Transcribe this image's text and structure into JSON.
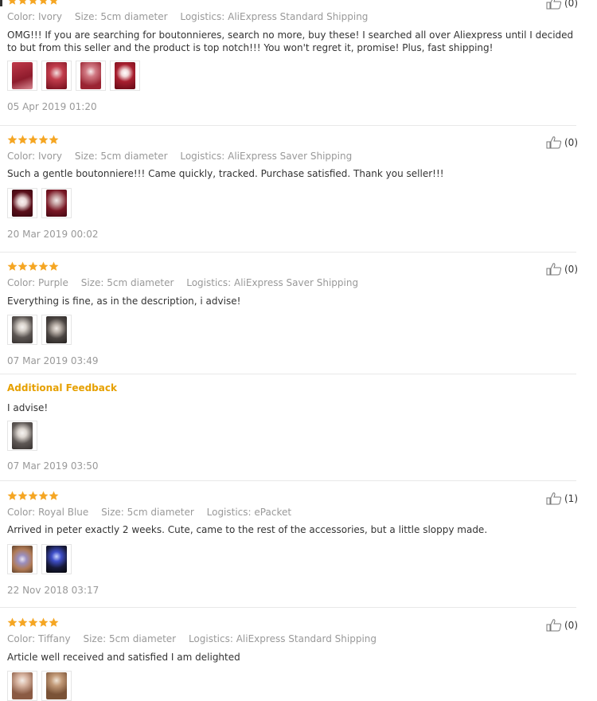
{
  "labels": {
    "color": "Color:",
    "size": "Size:",
    "logistics": "Logistics:",
    "additional_feedback": "Additional Feedback"
  },
  "colors": {
    "star": "#f5a623",
    "additional": "#e6a000"
  },
  "reviews": [
    {
      "stars": 5,
      "like_count": "(0)",
      "color": "Ivory",
      "size": "5cm diameter",
      "logistics": "AliExpress Standard Shipping",
      "text": "OMG!!! If you are searching for boutonnieres, search no more, buy these! I searched all over Aliexpress until I decided to but from this seller and the product is top notch!!! You won't regret it, promise! Plus, fast shipping!",
      "photos": 4,
      "date": "05 Apr 2019 01:20"
    },
    {
      "stars": 5,
      "like_count": "(0)",
      "color": "Ivory",
      "size": "5cm diameter",
      "logistics": "AliExpress Saver Shipping",
      "text": "Such a gentle boutonniere!!! Came quickly, tracked. Purchase satisfied. Thank you seller!!!",
      "photos": 2,
      "date": "20 Mar 2019 00:02"
    },
    {
      "stars": 5,
      "like_count": "(0)",
      "color": "Purple",
      "size": "5cm diameter",
      "logistics": "AliExpress Saver Shipping",
      "text": "Everything is fine, as in the description, i advise!",
      "photos": 2,
      "date": "07 Mar 2019 03:49",
      "additional": {
        "text": "I advise!",
        "photos": 1,
        "date": "07 Mar 2019 03:50"
      }
    },
    {
      "stars": 5,
      "like_count": "(1)",
      "color": "Royal Blue",
      "size": "5cm diameter",
      "logistics": "ePacket",
      "text": "Arrived in peter exactly 2 weeks. Cute, came to the rest of the accessories, but a little sloppy made.",
      "photos": 2,
      "date": "22 Nov 2018 03:17"
    },
    {
      "stars": 5,
      "like_count": "(0)",
      "color": "Tiffany",
      "size": "5cm diameter",
      "logistics": "AliExpress Standard Shipping",
      "text": "Article well received and satisfied I am delighted",
      "photos": 2
    }
  ]
}
